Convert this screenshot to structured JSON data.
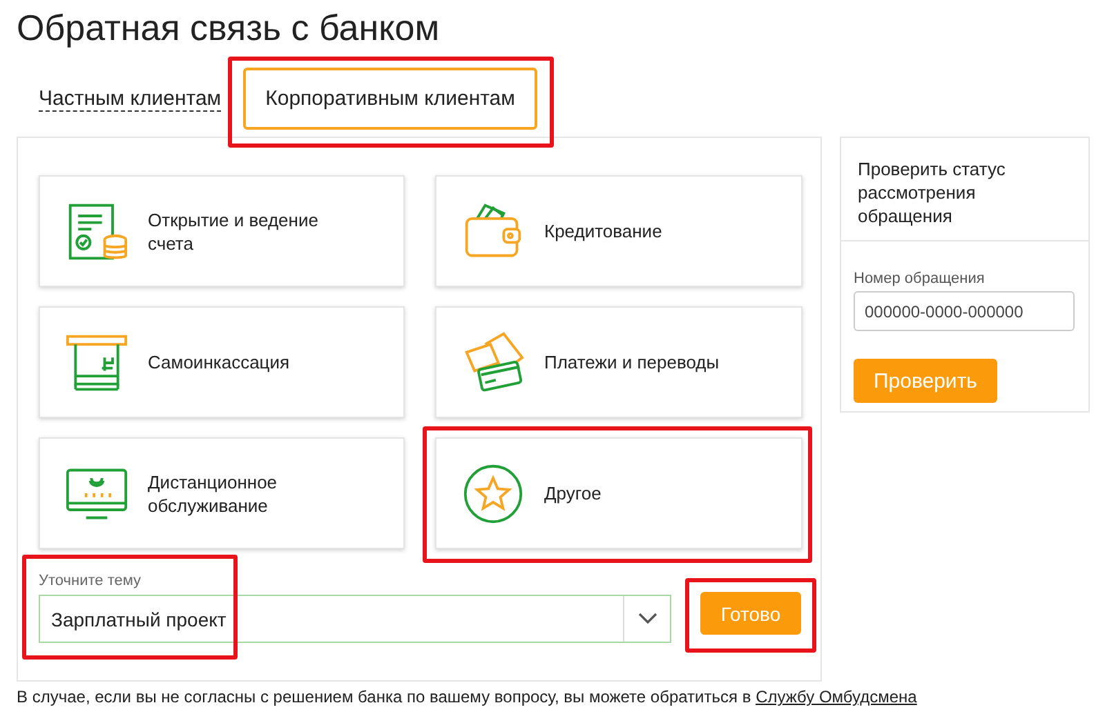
{
  "title": "Обратная связь с банком",
  "tabs": [
    {
      "label": "Частным клиентам",
      "selected": false,
      "highlighted": false
    },
    {
      "label": "Корпоративным клиентам",
      "selected": true,
      "highlighted": true
    }
  ],
  "topics": [
    {
      "kind": "account",
      "label": "Открытие и ведение счета",
      "highlighted": false
    },
    {
      "kind": "credit",
      "label": "Кредитование",
      "highlighted": false
    },
    {
      "kind": "cash",
      "label": "Самоинкассация",
      "highlighted": false
    },
    {
      "kind": "payments",
      "label": "Платежи и переводы",
      "highlighted": false
    },
    {
      "kind": "remote",
      "label": "Дистанционное обслуживание",
      "highlighted": false
    },
    {
      "kind": "other",
      "label": "Другое",
      "highlighted": true
    }
  ],
  "subject": {
    "label": "Уточните тему",
    "value": "Зарплатный проект",
    "highlighted": true
  },
  "submit": {
    "label": "Готово",
    "highlighted": true
  },
  "status_check": {
    "title": "Проверить статус рассмотрения обращения",
    "field_label": "Номер обращения",
    "placeholder": "000000-0000-000000",
    "button": "Проверить"
  },
  "footer": {
    "text": "В случае, если вы не согласны с решением банка по вашему вопросу, вы можете обратиться в",
    "link": "Службу Омбудсмена"
  }
}
